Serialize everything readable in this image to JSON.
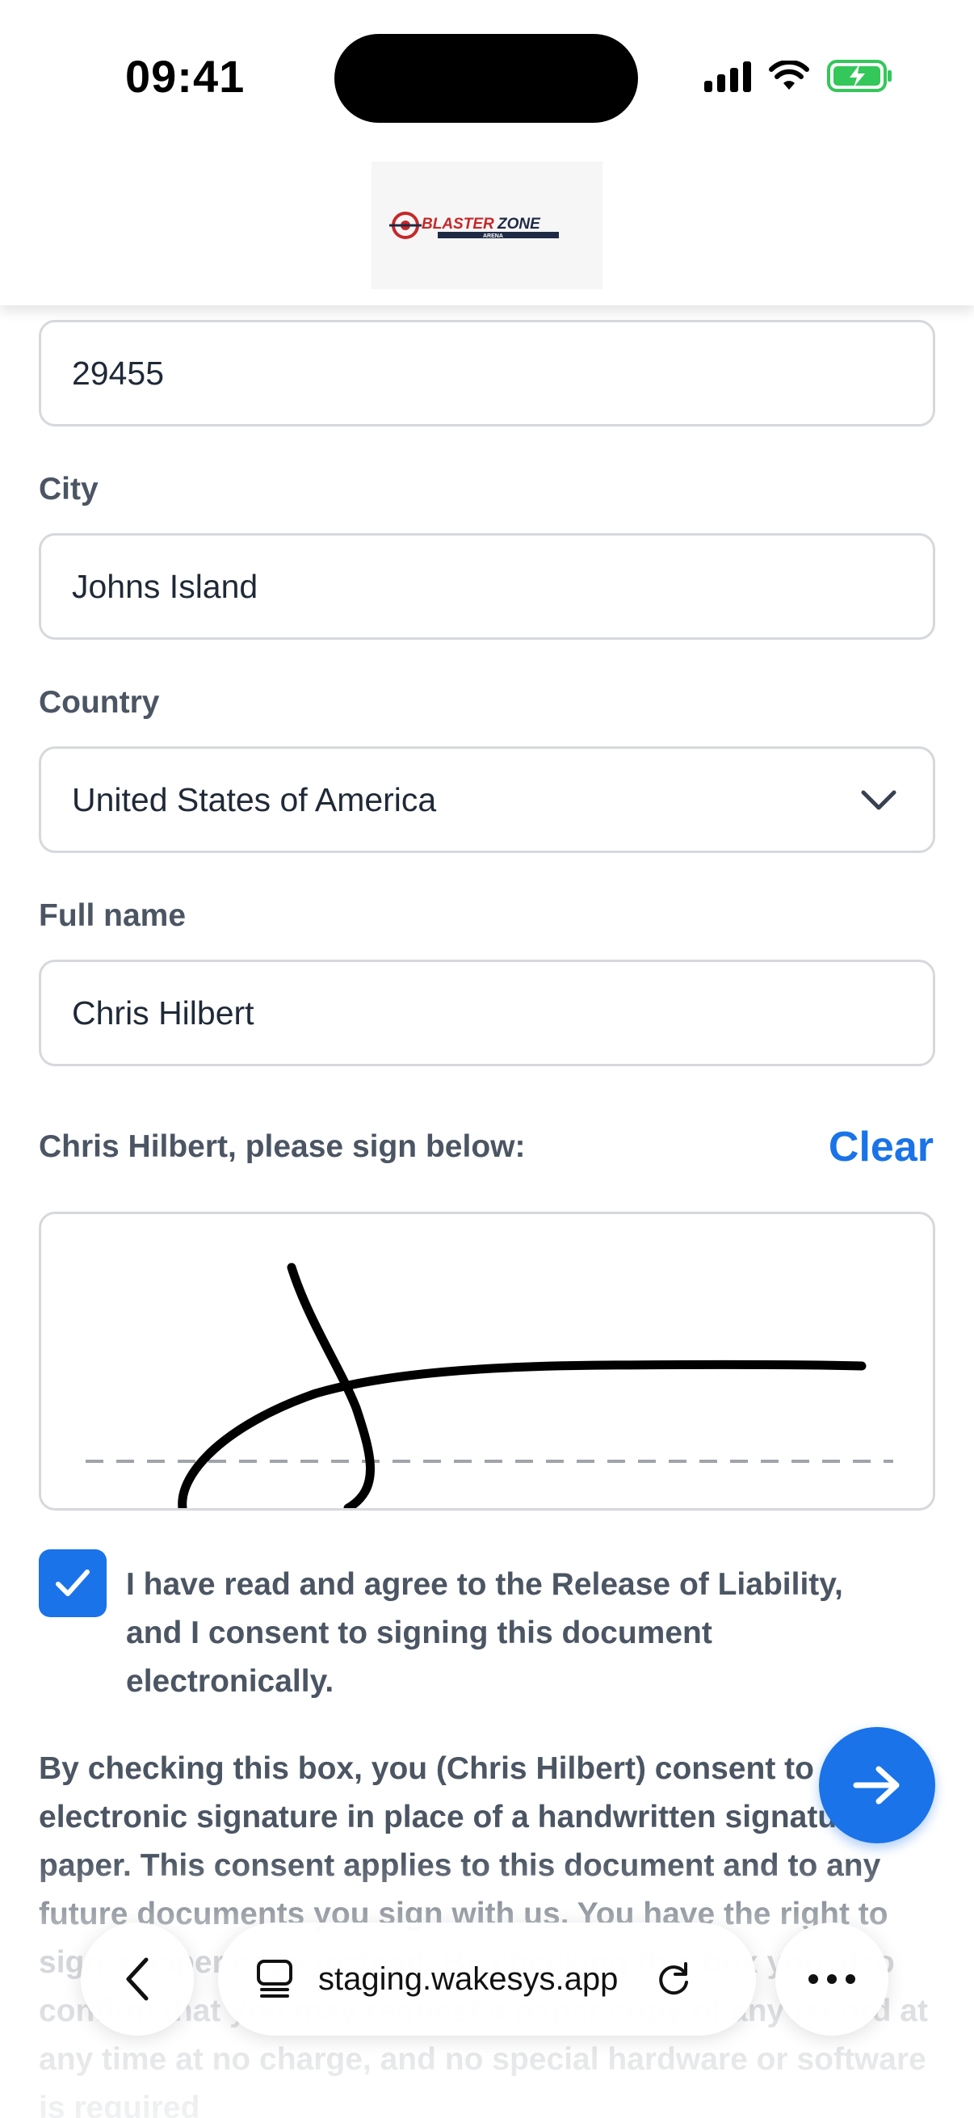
{
  "status_bar": {
    "time": "09:41"
  },
  "header": {
    "logo_text": "BLASTERZONE",
    "logo_subtext": "ARENA"
  },
  "form": {
    "zip_value": "29455",
    "city_label": "City",
    "city_value": "Johns Island",
    "country_label": "Country",
    "country_value": "United States of America",
    "fullname_label": "Full name",
    "fullname_value": "Chris Hilbert",
    "sign_prompt": "Chris Hilbert, please sign below:",
    "clear_label": "Clear",
    "consent_checked": true,
    "consent_text": "I have read and agree to the Release of Liability, and I consent to signing this document electronically.",
    "disclosure_text": "By checking this box, you (Chris Hilbert) consent to an electronic signature in place of a handwritten signature on paper. This consent applies to this document and to any future documents you sign with us. You have the right to sign a paper copy instead. By checking this box you also confirm that you may request a paper copy of any record at any time at no charge, and no special hardware or software is required"
  },
  "browser": {
    "url": "staging.wakesys.app"
  },
  "colors": {
    "accent": "#1a73e8",
    "label": "#4b5563",
    "border": "#d6d8dc",
    "battery": "#34c759"
  }
}
